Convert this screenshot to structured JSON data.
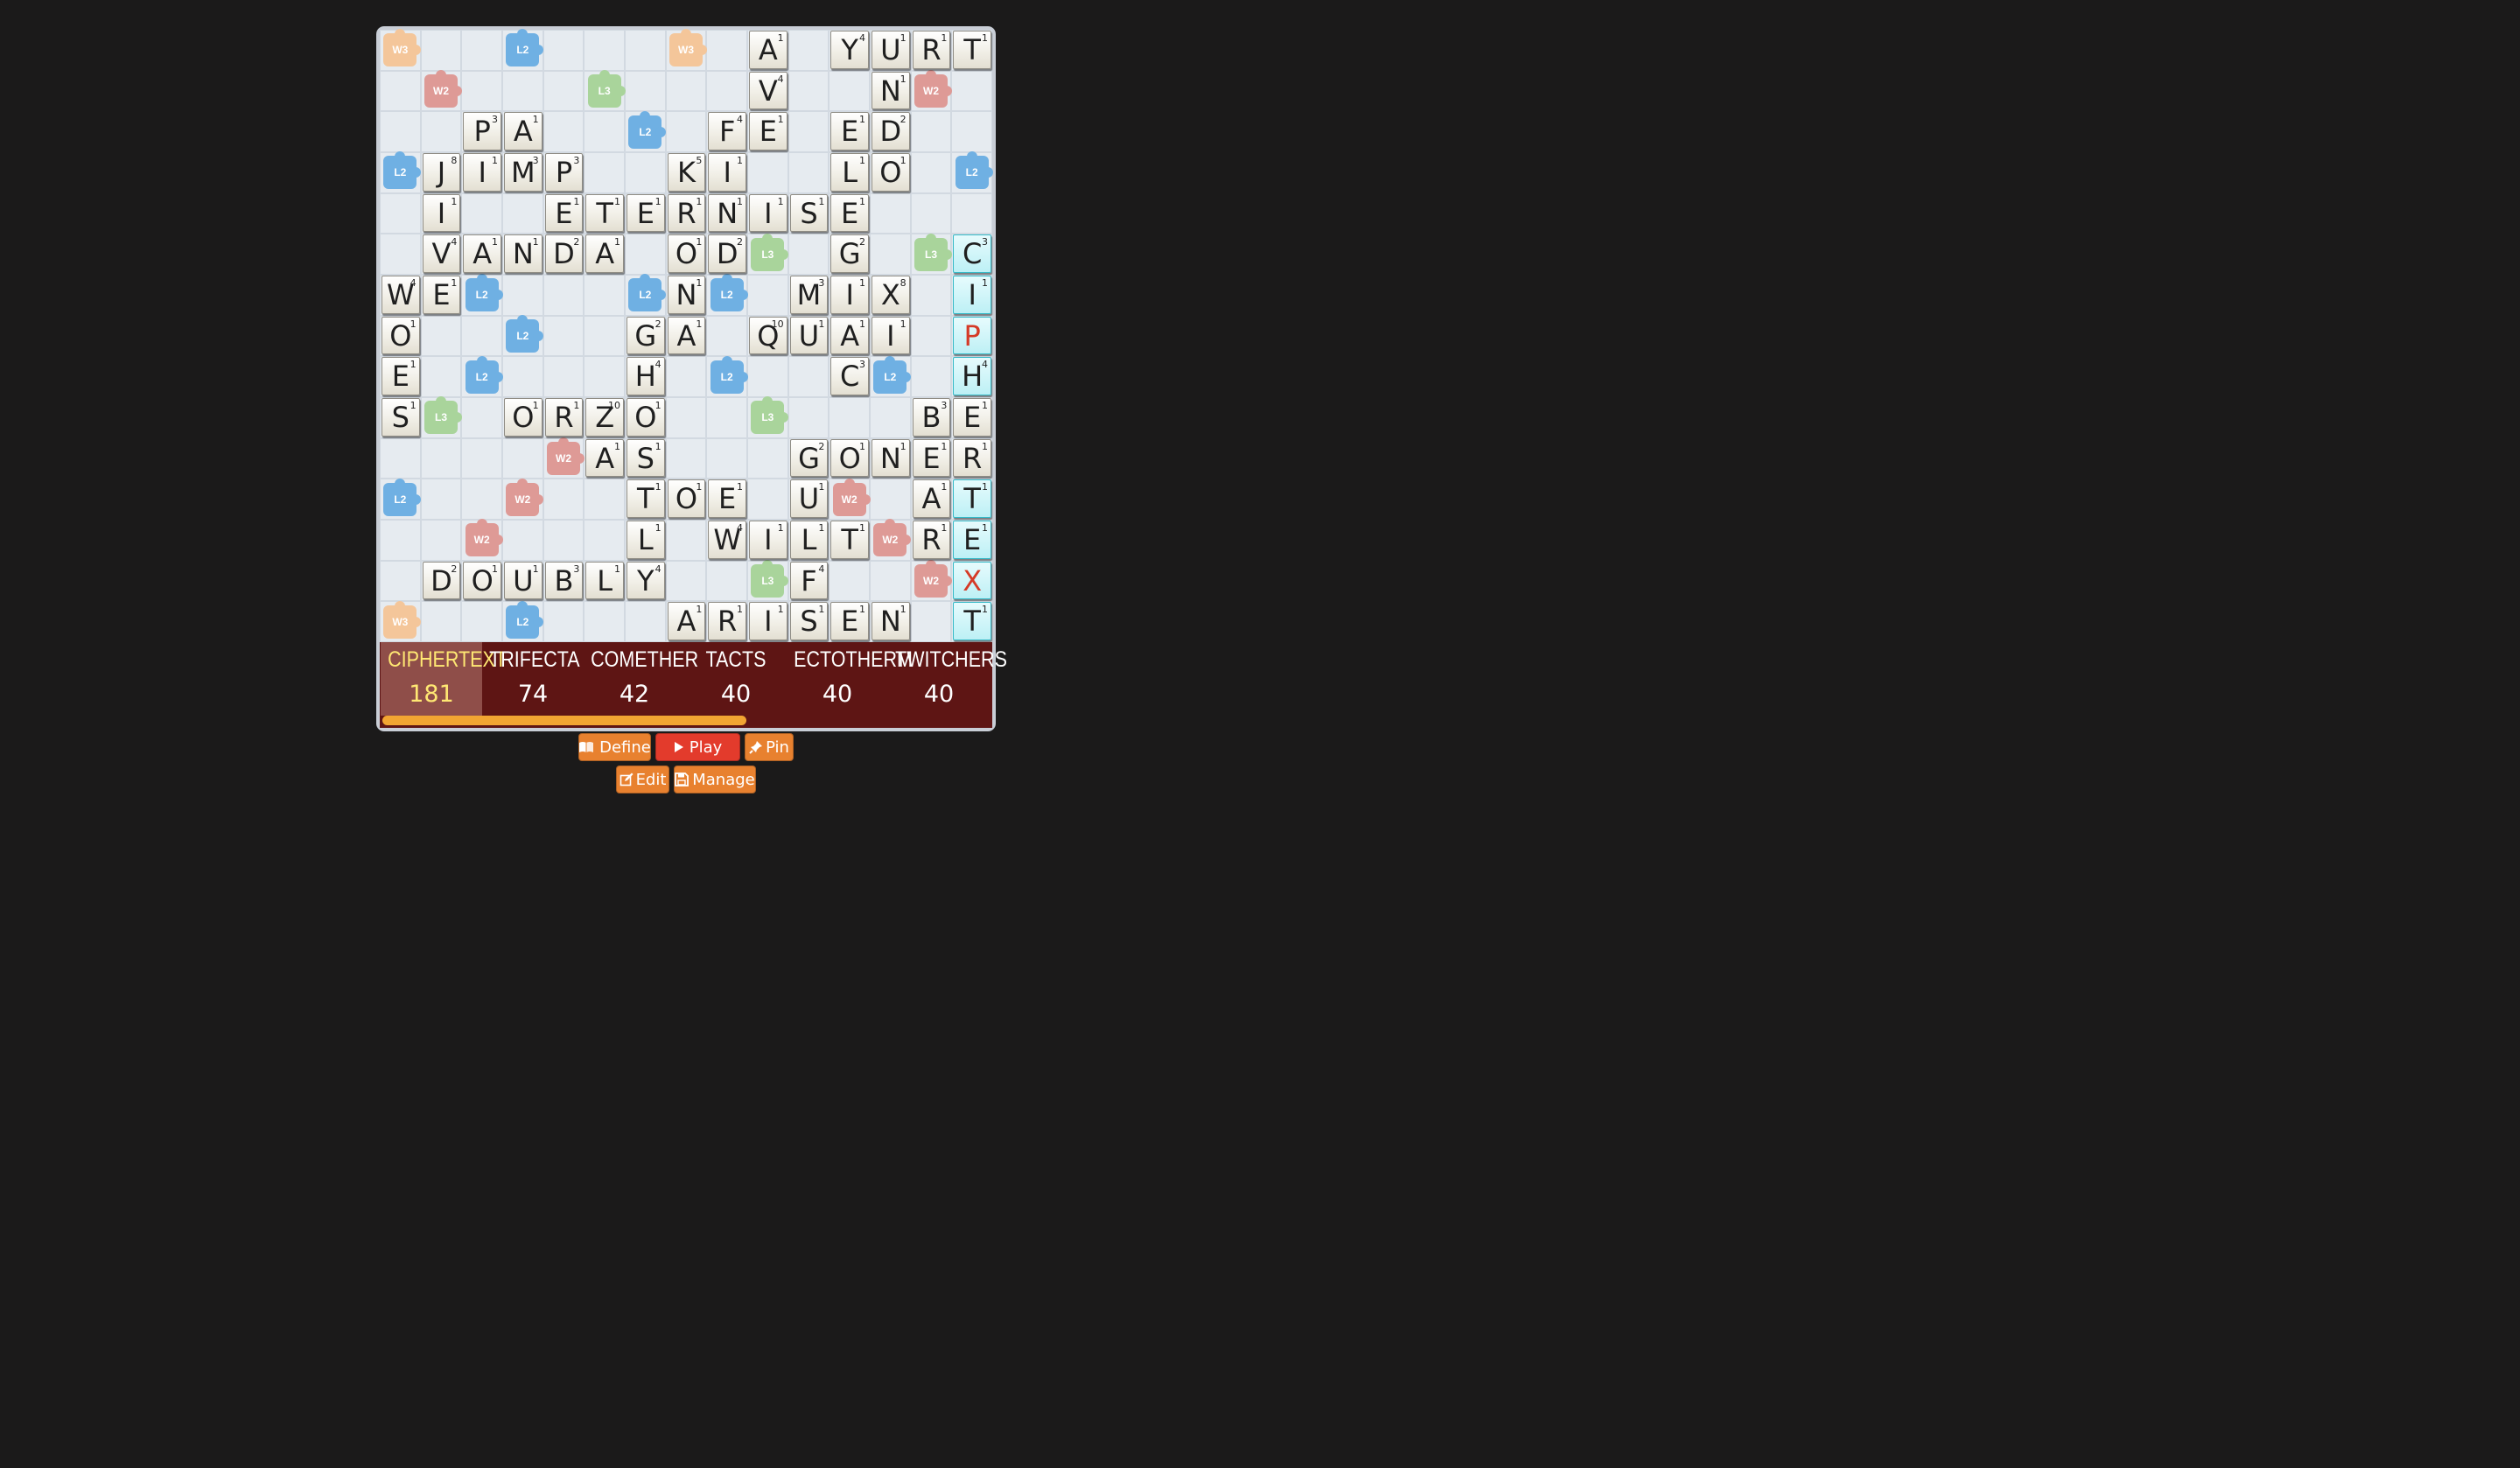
{
  "colors": {
    "w3": "#f4c69a",
    "w2": "#de9a96",
    "l2": "#6fb0e3",
    "l3": "#a9d49b",
    "accent_orange": "#e8812f",
    "play_red": "#e33b2c",
    "selected_word": "#ffe873"
  },
  "bonuses": [
    {
      "r": 0,
      "c": 0,
      "t": "W3"
    },
    {
      "r": 0,
      "c": 3,
      "t": "L2"
    },
    {
      "r": 0,
      "c": 7,
      "t": "W3"
    },
    {
      "r": 1,
      "c": 1,
      "t": "W2"
    },
    {
      "r": 1,
      "c": 5,
      "t": "L3"
    },
    {
      "r": 1,
      "c": 13,
      "t": "W2"
    },
    {
      "r": 2,
      "c": 6,
      "t": "L2"
    },
    {
      "r": 3,
      "c": 0,
      "t": "L2"
    },
    {
      "r": 3,
      "c": 14,
      "t": "L2"
    },
    {
      "r": 5,
      "c": 9,
      "t": "L3"
    },
    {
      "r": 5,
      "c": 13,
      "t": "L3"
    },
    {
      "r": 6,
      "c": 2,
      "t": "L2"
    },
    {
      "r": 6,
      "c": 6,
      "t": "L2"
    },
    {
      "r": 6,
      "c": 8,
      "t": "L2"
    },
    {
      "r": 7,
      "c": 3,
      "t": "L2"
    },
    {
      "r": 8,
      "c": 2,
      "t": "L2"
    },
    {
      "r": 8,
      "c": 8,
      "t": "L2"
    },
    {
      "r": 8,
      "c": 12,
      "t": "L2"
    },
    {
      "r": 9,
      "c": 1,
      "t": "L3"
    },
    {
      "r": 9,
      "c": 9,
      "t": "L3"
    },
    {
      "r": 10,
      "c": 4,
      "t": "W2"
    },
    {
      "r": 11,
      "c": 0,
      "t": "L2"
    },
    {
      "r": 11,
      "c": 3,
      "t": "W2"
    },
    {
      "r": 11,
      "c": 11,
      "t": "W2"
    },
    {
      "r": 12,
      "c": 2,
      "t": "W2"
    },
    {
      "r": 12,
      "c": 12,
      "t": "W2"
    },
    {
      "r": 13,
      "c": 9,
      "t": "L3"
    },
    {
      "r": 13,
      "c": 13,
      "t": "W2"
    },
    {
      "r": 14,
      "c": 0,
      "t": "W3"
    },
    {
      "r": 14,
      "c": 3,
      "t": "L2"
    }
  ],
  "tiles": [
    {
      "r": 0,
      "c": 9,
      "l": "A",
      "p": "1"
    },
    {
      "r": 0,
      "c": 11,
      "l": "Y",
      "p": "4"
    },
    {
      "r": 0,
      "c": 12,
      "l": "U",
      "p": "1"
    },
    {
      "r": 0,
      "c": 13,
      "l": "R",
      "p": "1"
    },
    {
      "r": 0,
      "c": 14,
      "l": "T",
      "p": "1"
    },
    {
      "r": 1,
      "c": 9,
      "l": "V",
      "p": "4"
    },
    {
      "r": 1,
      "c": 12,
      "l": "N",
      "p": "1"
    },
    {
      "r": 2,
      "c": 2,
      "l": "P",
      "p": "3"
    },
    {
      "r": 2,
      "c": 3,
      "l": "A",
      "p": "1"
    },
    {
      "r": 2,
      "c": 8,
      "l": "F",
      "p": "4"
    },
    {
      "r": 2,
      "c": 9,
      "l": "E",
      "p": "1"
    },
    {
      "r": 2,
      "c": 11,
      "l": "E",
      "p": "1"
    },
    {
      "r": 2,
      "c": 12,
      "l": "D",
      "p": "2"
    },
    {
      "r": 3,
      "c": 1,
      "l": "J",
      "p": "8"
    },
    {
      "r": 3,
      "c": 2,
      "l": "I",
      "p": "1"
    },
    {
      "r": 3,
      "c": 3,
      "l": "M",
      "p": "3"
    },
    {
      "r": 3,
      "c": 4,
      "l": "P",
      "p": "3"
    },
    {
      "r": 3,
      "c": 7,
      "l": "K",
      "p": "5"
    },
    {
      "r": 3,
      "c": 8,
      "l": "I",
      "p": "1"
    },
    {
      "r": 3,
      "c": 11,
      "l": "L",
      "p": "1"
    },
    {
      "r": 3,
      "c": 12,
      "l": "O",
      "p": "1"
    },
    {
      "r": 4,
      "c": 1,
      "l": "I",
      "p": "1"
    },
    {
      "r": 4,
      "c": 4,
      "l": "E",
      "p": "1"
    },
    {
      "r": 4,
      "c": 5,
      "l": "T",
      "p": "1"
    },
    {
      "r": 4,
      "c": 6,
      "l": "E",
      "p": "1"
    },
    {
      "r": 4,
      "c": 7,
      "l": "R",
      "p": "1"
    },
    {
      "r": 4,
      "c": 8,
      "l": "N",
      "p": "1"
    },
    {
      "r": 4,
      "c": 9,
      "l": "I",
      "p": "1"
    },
    {
      "r": 4,
      "c": 10,
      "l": "S",
      "p": "1"
    },
    {
      "r": 4,
      "c": 11,
      "l": "E",
      "p": "1"
    },
    {
      "r": 5,
      "c": 1,
      "l": "V",
      "p": "4"
    },
    {
      "r": 5,
      "c": 2,
      "l": "A",
      "p": "1"
    },
    {
      "r": 5,
      "c": 3,
      "l": "N",
      "p": "1"
    },
    {
      "r": 5,
      "c": 4,
      "l": "D",
      "p": "2"
    },
    {
      "r": 5,
      "c": 5,
      "l": "A",
      "p": "1"
    },
    {
      "r": 5,
      "c": 7,
      "l": "O",
      "p": "1"
    },
    {
      "r": 5,
      "c": 8,
      "l": "D",
      "p": "2"
    },
    {
      "r": 5,
      "c": 11,
      "l": "G",
      "p": "2"
    },
    {
      "r": 5,
      "c": 14,
      "l": "C",
      "p": "3",
      "hl": true
    },
    {
      "r": 6,
      "c": 0,
      "l": "W",
      "p": "4"
    },
    {
      "r": 6,
      "c": 1,
      "l": "E",
      "p": "1"
    },
    {
      "r": 6,
      "c": 7,
      "l": "N",
      "p": "1"
    },
    {
      "r": 6,
      "c": 10,
      "l": "M",
      "p": "3"
    },
    {
      "r": 6,
      "c": 11,
      "l": "I",
      "p": "1"
    },
    {
      "r": 6,
      "c": 12,
      "l": "X",
      "p": "8"
    },
    {
      "r": 6,
      "c": 14,
      "l": "I",
      "p": "1",
      "hl": true
    },
    {
      "r": 7,
      "c": 0,
      "l": "O",
      "p": "1"
    },
    {
      "r": 7,
      "c": 6,
      "l": "G",
      "p": "2"
    },
    {
      "r": 7,
      "c": 7,
      "l": "A",
      "p": "1"
    },
    {
      "r": 7,
      "c": 9,
      "l": "Q",
      "p": "10"
    },
    {
      "r": 7,
      "c": 10,
      "l": "U",
      "p": "1"
    },
    {
      "r": 7,
      "c": 11,
      "l": "A",
      "p": "1"
    },
    {
      "r": 7,
      "c": 12,
      "l": "I",
      "p": "1"
    },
    {
      "r": 7,
      "c": 14,
      "l": "P",
      "p": "",
      "hl": true,
      "red": true
    },
    {
      "r": 8,
      "c": 0,
      "l": "E",
      "p": "1"
    },
    {
      "r": 8,
      "c": 6,
      "l": "H",
      "p": "4"
    },
    {
      "r": 8,
      "c": 11,
      "l": "C",
      "p": "3"
    },
    {
      "r": 8,
      "c": 14,
      "l": "H",
      "p": "4",
      "hl": true
    },
    {
      "r": 9,
      "c": 0,
      "l": "S",
      "p": "1"
    },
    {
      "r": 9,
      "c": 3,
      "l": "O",
      "p": "1"
    },
    {
      "r": 9,
      "c": 4,
      "l": "R",
      "p": "1"
    },
    {
      "r": 9,
      "c": 5,
      "l": "Z",
      "p": "10"
    },
    {
      "r": 9,
      "c": 6,
      "l": "O",
      "p": "1"
    },
    {
      "r": 9,
      "c": 13,
      "l": "B",
      "p": "3"
    },
    {
      "r": 9,
      "c": 14,
      "l": "E",
      "p": "1"
    },
    {
      "r": 10,
      "c": 5,
      "l": "A",
      "p": "1"
    },
    {
      "r": 10,
      "c": 6,
      "l": "S",
      "p": "1"
    },
    {
      "r": 10,
      "c": 10,
      "l": "G",
      "p": "2"
    },
    {
      "r": 10,
      "c": 11,
      "l": "O",
      "p": "1"
    },
    {
      "r": 10,
      "c": 12,
      "l": "N",
      "p": "1"
    },
    {
      "r": 10,
      "c": 13,
      "l": "E",
      "p": "1"
    },
    {
      "r": 10,
      "c": 14,
      "l": "R",
      "p": "1"
    },
    {
      "r": 11,
      "c": 6,
      "l": "T",
      "p": "1"
    },
    {
      "r": 11,
      "c": 7,
      "l": "O",
      "p": "1"
    },
    {
      "r": 11,
      "c": 8,
      "l": "E",
      "p": "1"
    },
    {
      "r": 11,
      "c": 10,
      "l": "U",
      "p": "1"
    },
    {
      "r": 11,
      "c": 13,
      "l": "A",
      "p": "1"
    },
    {
      "r": 11,
      "c": 14,
      "l": "T",
      "p": "1",
      "hl": true
    },
    {
      "r": 12,
      "c": 6,
      "l": "L",
      "p": "1"
    },
    {
      "r": 12,
      "c": 8,
      "l": "W",
      "p": "4"
    },
    {
      "r": 12,
      "c": 9,
      "l": "I",
      "p": "1"
    },
    {
      "r": 12,
      "c": 10,
      "l": "L",
      "p": "1"
    },
    {
      "r": 12,
      "c": 11,
      "l": "T",
      "p": "1"
    },
    {
      "r": 12,
      "c": 13,
      "l": "R",
      "p": "1"
    },
    {
      "r": 12,
      "c": 14,
      "l": "E",
      "p": "1",
      "hl": true
    },
    {
      "r": 13,
      "c": 1,
      "l": "D",
      "p": "2"
    },
    {
      "r": 13,
      "c": 2,
      "l": "O",
      "p": "1"
    },
    {
      "r": 13,
      "c": 3,
      "l": "U",
      "p": "1"
    },
    {
      "r": 13,
      "c": 4,
      "l": "B",
      "p": "3"
    },
    {
      "r": 13,
      "c": 5,
      "l": "L",
      "p": "1"
    },
    {
      "r": 13,
      "c": 6,
      "l": "Y",
      "p": "4"
    },
    {
      "r": 13,
      "c": 10,
      "l": "F",
      "p": "4"
    },
    {
      "r": 13,
      "c": 14,
      "l": "X",
      "p": "",
      "hl": true,
      "red": true
    },
    {
      "r": 14,
      "c": 7,
      "l": "A",
      "p": "1"
    },
    {
      "r": 14,
      "c": 8,
      "l": "R",
      "p": "1"
    },
    {
      "r": 14,
      "c": 9,
      "l": "I",
      "p": "1"
    },
    {
      "r": 14,
      "c": 10,
      "l": "S",
      "p": "1"
    },
    {
      "r": 14,
      "c": 11,
      "l": "E",
      "p": "1"
    },
    {
      "r": 14,
      "c": 12,
      "l": "N",
      "p": "1"
    },
    {
      "r": 14,
      "c": 14,
      "l": "T",
      "p": "1",
      "hl": true
    }
  ],
  "words": [
    {
      "word": "CIPHERTEXT",
      "score": "181",
      "selected": true
    },
    {
      "word": "TRIFECTA",
      "score": "74"
    },
    {
      "word": "COMETHER",
      "score": "42"
    },
    {
      "word": "TACTS",
      "score": "40"
    },
    {
      "word": "ECTOTHERM",
      "score": "40"
    },
    {
      "word": "TWITCHERS",
      "score": "40"
    }
  ],
  "progress": 0.6,
  "buttons": {
    "define": "Define",
    "play": "Play",
    "pin": "Pin",
    "edit": "Edit",
    "manage": "Manage"
  },
  "icons": {
    "define": "book-icon",
    "play": "play-icon",
    "pin": "pin-icon",
    "edit": "edit-icon",
    "manage": "save-icon"
  }
}
